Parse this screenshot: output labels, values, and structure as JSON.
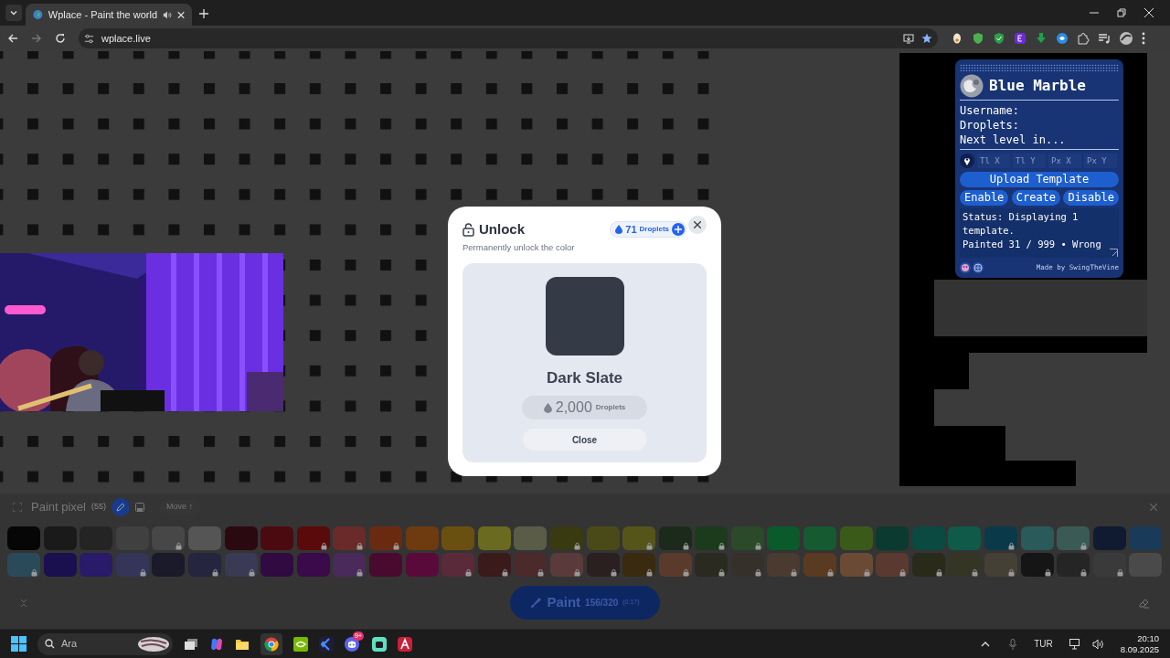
{
  "browser": {
    "tab_title": "Wplace - Paint the world",
    "address": "wplace.live"
  },
  "blue_marble": {
    "title": "Blue Marble",
    "info": [
      "Username:",
      "Droplets:",
      "Next level in..."
    ],
    "coords": [
      {
        "placeholder": "Tl X"
      },
      {
        "placeholder": "Tl Y"
      },
      {
        "placeholder": "Px X"
      },
      {
        "placeholder": "Px Y"
      }
    ],
    "upload_button": "Upload Template",
    "buttons": [
      "Enable",
      "Create",
      "Disable"
    ],
    "status": [
      "Status: Displaying 1 template.",
      "Painted 31 / 999 • Wrong"
    ],
    "credit": "Made by SwingTheVine"
  },
  "modal": {
    "title": "Unlock",
    "droplet_count": "71",
    "droplet_unit": "Droplets",
    "subtitle": "Permanently unlock the color",
    "color_name": "Dark Slate",
    "color": "#353a47",
    "price": "2,000",
    "price_unit": "Droplets",
    "price_disabled": true,
    "close": "Close"
  },
  "toolbar": {
    "title": "Paint pixel",
    "count": "(55)",
    "move": "Move ↑"
  },
  "palette": [
    [
      {
        "color": "#060606",
        "locked": false
      },
      {
        "color": "#1a1a1a",
        "locked": false
      },
      {
        "color": "#242424",
        "locked": false
      },
      {
        "color": "#404040",
        "locked": false
      },
      {
        "color": "#474747",
        "locked": true
      },
      {
        "color": "#555555",
        "locked": false
      },
      {
        "color": "#2a0a10",
        "locked": false
      },
      {
        "color": "#4a0a10",
        "locked": false
      },
      {
        "color": "#5a0a0a",
        "locked": true
      },
      {
        "color": "#6a2a2a",
        "locked": true
      },
      {
        "color": "#6a2a10",
        "locked": true
      },
      {
        "color": "#6e3a10",
        "locked": false
      },
      {
        "color": "#6a5010",
        "locked": false
      },
      {
        "color": "#6a6a20",
        "locked": false
      },
      {
        "color": "#5a5c48",
        "locked": false
      },
      {
        "color": "#3a3a10",
        "locked": true
      },
      {
        "color": "#4a4a18",
        "locked": false
      },
      {
        "color": "#55551a",
        "locked": true
      },
      {
        "color": "#1c2a1c",
        "locked": true
      },
      {
        "color": "#1c3a1c",
        "locked": true
      },
      {
        "color": "#2a4a2a",
        "locked": true
      },
      {
        "color": "#0a5a2a",
        "locked": false
      },
      {
        "color": "#155a30",
        "locked": false
      },
      {
        "color": "#3a5a1a",
        "locked": false
      },
      {
        "color": "#0a3a30",
        "locked": false
      },
      {
        "color": "#0a4a40",
        "locked": false
      },
      {
        "color": "#105a4a",
        "locked": false
      },
      {
        "color": "#0a3a4a",
        "locked": true
      },
      {
        "color": "#2a5a5a",
        "locked": false
      },
      {
        "color": "#3a5a55",
        "locked": true
      },
      {
        "color": "#101a30",
        "locked": false
      },
      {
        "color": "#1a3a5a",
        "locked": false
      }
    ],
    [
      {
        "color": "#2a4a5a",
        "locked": true
      },
      {
        "color": "#1a1050",
        "locked": false
      },
      {
        "color": "#2a1a6a",
        "locked": false
      },
      {
        "color": "#35355a",
        "locked": true
      },
      {
        "color": "#1a1a2a",
        "locked": false
      },
      {
        "color": "#252540",
        "locked": true
      },
      {
        "color": "#3a3a55",
        "locked": true
      },
      {
        "color": "#300a40",
        "locked": false
      },
      {
        "color": "#3a0a4a",
        "locked": false
      },
      {
        "color": "#4a2a5a",
        "locked": true
      },
      {
        "color": "#4a0a30",
        "locked": false
      },
      {
        "color": "#5a0a3a",
        "locked": false
      },
      {
        "color": "#5a2a3a",
        "locked": true
      },
      {
        "color": "#3a1a1a",
        "locked": true
      },
      {
        "color": "#4a2a2a",
        "locked": true
      },
      {
        "color": "#5a3a3a",
        "locked": true
      },
      {
        "color": "#2a2020",
        "locked": true
      },
      {
        "color": "#3a2a10",
        "locked": true
      },
      {
        "color": "#5a3a2a",
        "locked": true
      },
      {
        "color": "#2a2a20",
        "locked": true
      },
      {
        "color": "#35302a",
        "locked": true
      },
      {
        "color": "#4a3a30",
        "locked": true
      },
      {
        "color": "#5a3a20",
        "locked": true
      },
      {
        "color": "#6a4a35",
        "locked": true
      },
      {
        "color": "#5a3a30",
        "locked": true
      },
      {
        "color": "#2a2a1a",
        "locked": true
      },
      {
        "color": "#353525",
        "locked": true
      },
      {
        "color": "#454035",
        "locked": true
      },
      {
        "color": "#151515",
        "locked": true
      },
      {
        "color": "#252525",
        "locked": true
      },
      {
        "color": "#3a3a3a",
        "locked": true
      },
      {
        "color": "#4a4a4a",
        "locked": false
      }
    ]
  ],
  "paint_button": {
    "label": "Paint",
    "charges": "156/320",
    "timer": "(0:17)"
  },
  "taskbar": {
    "search_placeholder": "Ara",
    "discord_badge": "9+",
    "language": "TUR",
    "time": "20:10",
    "date": "8.09.2025"
  }
}
